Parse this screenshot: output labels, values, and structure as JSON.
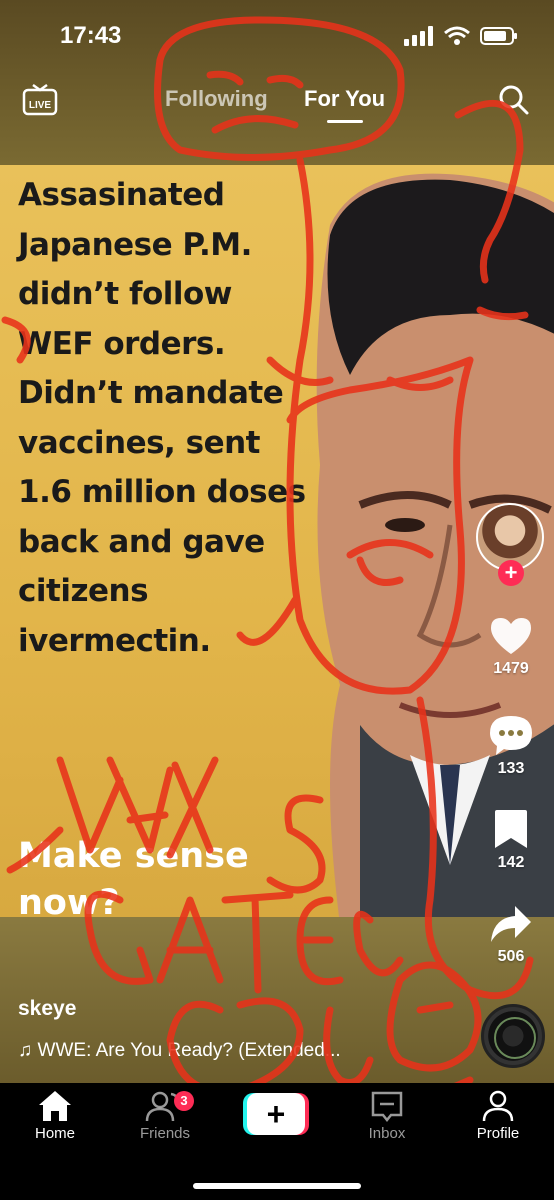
{
  "status_bar": {
    "time": "17:43"
  },
  "top_nav": {
    "live_label": "LIVE",
    "tabs": [
      {
        "label": "Following",
        "active": false
      },
      {
        "label": "For You",
        "active": true
      }
    ]
  },
  "post": {
    "text_lines": [
      "Assasinated",
      "Japanese P.M.",
      "didn’t follow",
      "WEF orders.",
      "Didn’t mandate",
      "vaccines, sent",
      "1.6 million doses",
      "back and gave",
      "citizens",
      "ivermectin."
    ],
    "question": [
      "Make sense",
      "now?"
    ],
    "username": "skeye",
    "music": "♫  WWE: Are You Ready? (Extended..."
  },
  "rail": {
    "likes": "1479",
    "comments": "133",
    "saves": "142",
    "shares": "506",
    "follow_symbol": "+"
  },
  "bottom_nav": {
    "items": [
      {
        "label": "Home"
      },
      {
        "label": "Friends",
        "badge": "3"
      },
      {
        "label": "+"
      },
      {
        "label": "Inbox"
      },
      {
        "label": "Profile"
      }
    ]
  },
  "colors": {
    "poster_bg": "#e6bb52",
    "accent": "#fe2c55",
    "teal": "#25f4ee",
    "scribble": "#e8321a"
  },
  "icons": [
    "live-icon",
    "search-icon",
    "heart-icon",
    "comment-icon",
    "bookmark-icon",
    "share-icon",
    "home-icon",
    "friends-icon",
    "inbox-icon",
    "profile-icon",
    "signal-icon",
    "wifi-icon",
    "battery-icon"
  ]
}
